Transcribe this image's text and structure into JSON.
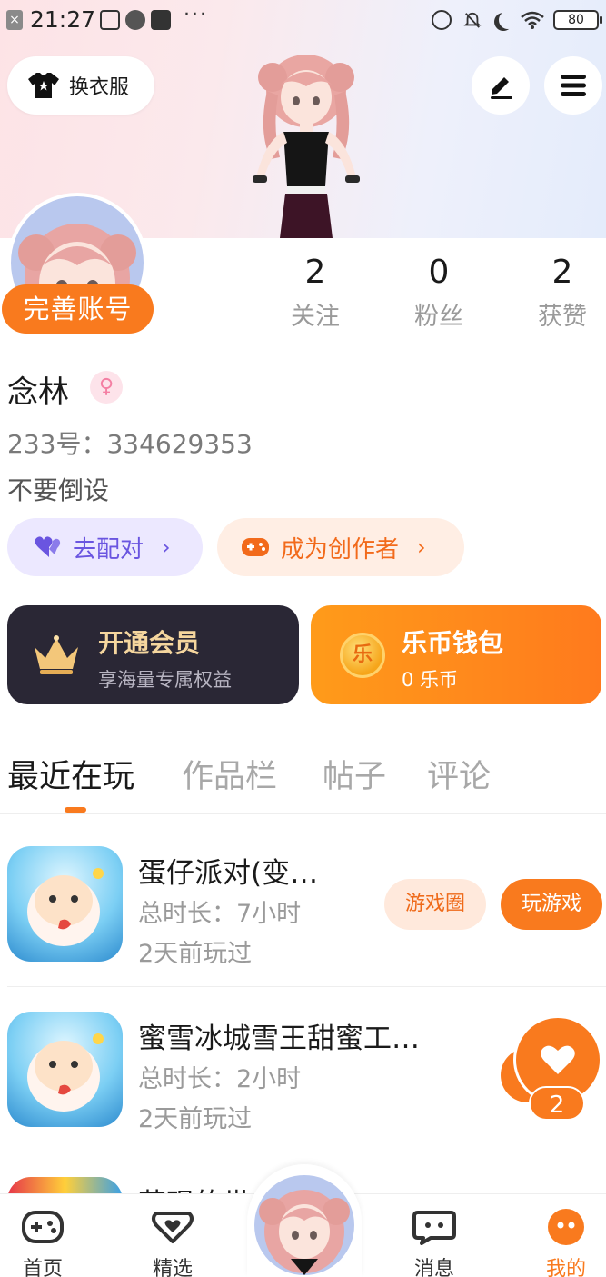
{
  "status_bar": {
    "time": "21:27",
    "battery": "80",
    "more": "···"
  },
  "header": {
    "outfit_label": "换衣服",
    "icons": [
      "tshirt-icon",
      "edit-icon",
      "menu-icon"
    ]
  },
  "profile": {
    "complete_label": "完善账号",
    "stats": [
      {
        "value": "2",
        "label": "关注"
      },
      {
        "value": "0",
        "label": "粉丝"
      },
      {
        "value": "2",
        "label": "获赞"
      }
    ],
    "name": "念林",
    "gender_symbol": "♀",
    "id_text": "233号：334629353",
    "bio": "不要倒设",
    "pair_label": "去配对",
    "creator_label": "成为创作者",
    "chevron": "›"
  },
  "cards": {
    "vip_title": "开通会员",
    "vip_sub": "享海量专属权益",
    "wallet_title": "乐币钱包",
    "wallet_sub": "0 乐币",
    "coin_char": "乐"
  },
  "tabs": [
    "最近在玩",
    "作品栏",
    "帖子",
    "评论"
  ],
  "games": [
    {
      "name": "蛋仔派对(变…",
      "duration": "总时长：7小时",
      "ago": "2天前玩过"
    },
    {
      "name": "蜜雪冰城雪王甜蜜工…",
      "duration": "总时长：2小时",
      "ago": "2天前玩过"
    },
    {
      "name": "花现的世…",
      "duration": "",
      "ago": ""
    }
  ],
  "game_actions": {
    "circle_label": "游戏圈",
    "play_label": "玩游戏"
  },
  "like": {
    "count": "2"
  },
  "nav": [
    {
      "label": "首页",
      "icon": "gamepad-icon"
    },
    {
      "label": "精选",
      "icon": "heart-tag-icon"
    },
    {
      "label": "消息",
      "icon": "chat-icon"
    },
    {
      "label": "我的",
      "icon": "face-icon"
    }
  ],
  "colors": {
    "accent": "#f97a1e",
    "pair": "#6a55e0",
    "vip_bg": "#2a2735",
    "vip_text": "#f5d69e"
  }
}
